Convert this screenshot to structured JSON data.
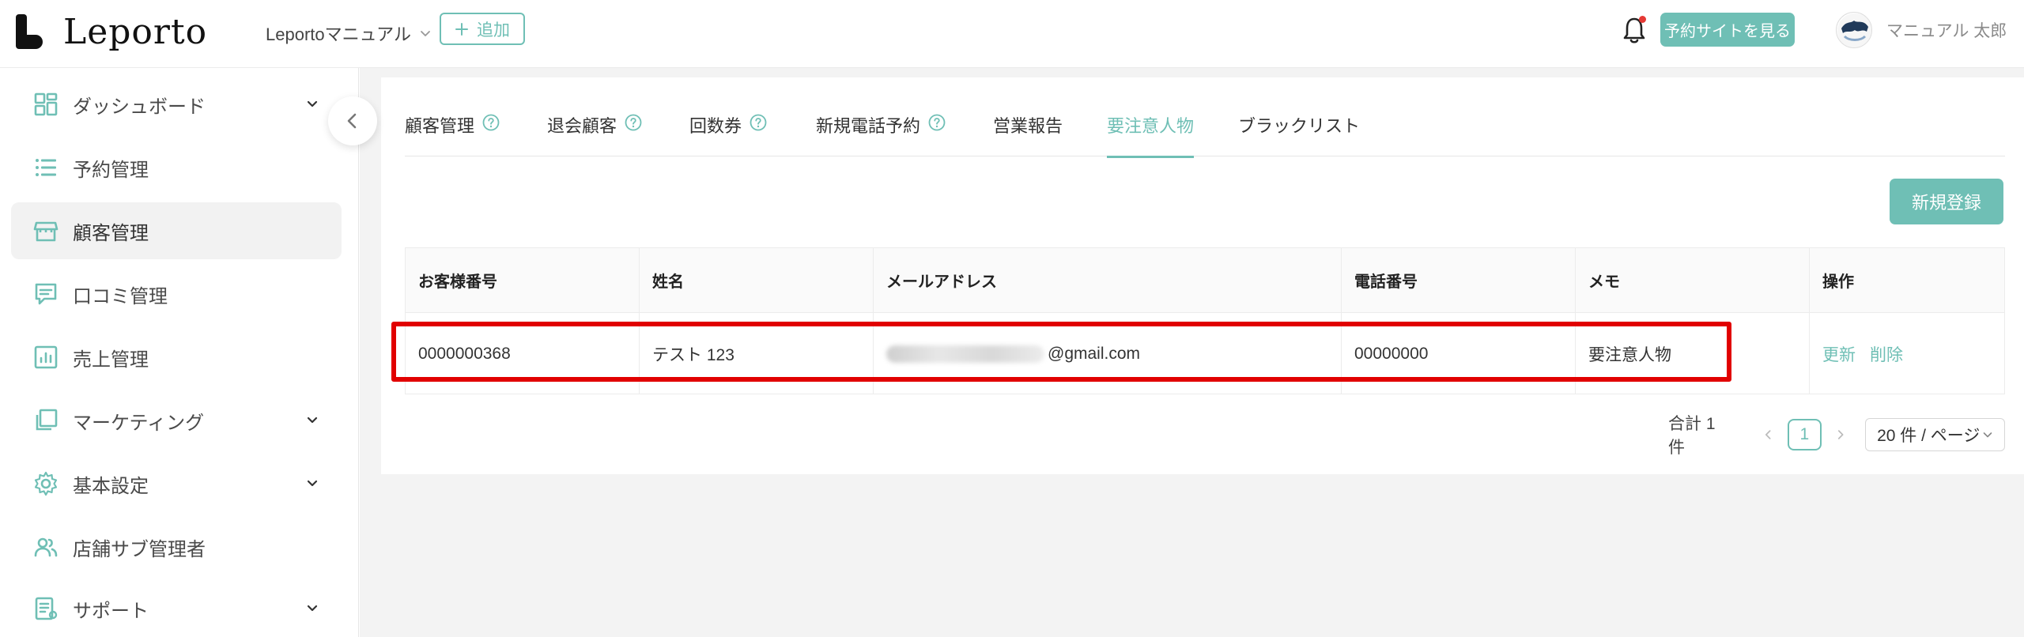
{
  "brand": {
    "name": "Leporto"
  },
  "header": {
    "store_name": "Leportoマニュアル",
    "add_label": "追加",
    "reserve_site_label": "予約サイトを見る",
    "user_name": "マニュアル 太郎"
  },
  "sidebar": {
    "items": [
      {
        "label": "ダッシュボード",
        "icon": "dashboard-icon",
        "has_caret": true
      },
      {
        "label": "予約管理",
        "icon": "list-icon",
        "has_caret": false
      },
      {
        "label": "顧客管理",
        "icon": "store-icon",
        "has_caret": false,
        "active": true
      },
      {
        "label": "口コミ管理",
        "icon": "comment-icon",
        "has_caret": false
      },
      {
        "label": "売上管理",
        "icon": "chart-icon",
        "has_caret": false
      },
      {
        "label": "マーケティング",
        "icon": "layers-icon",
        "has_caret": true
      },
      {
        "label": "基本設定",
        "icon": "gear-icon",
        "has_caret": true
      },
      {
        "label": "店舗サブ管理者",
        "icon": "users-icon",
        "has_caret": false
      },
      {
        "label": "サポート",
        "icon": "doc-icon",
        "has_caret": true
      }
    ]
  },
  "tabs": [
    {
      "label": "顧客管理",
      "help": true
    },
    {
      "label": "退会顧客",
      "help": true
    },
    {
      "label": "回数券",
      "help": true
    },
    {
      "label": "新規電話予約",
      "help": true
    },
    {
      "label": "営業報告",
      "help": false
    },
    {
      "label": "要注意人物",
      "help": false,
      "active": true
    },
    {
      "label": "ブラックリスト",
      "help": false
    }
  ],
  "actions": {
    "new_label": "新規登録"
  },
  "table": {
    "columns": [
      "お客様番号",
      "姓名",
      "メールアドレス",
      "電話番号",
      "メモ",
      "操作"
    ],
    "rows": [
      {
        "customer_no": "0000000368",
        "name": "テスト 123",
        "email_suffix": "@gmail.com",
        "phone": "00000000",
        "memo": "要注意人物",
        "update_label": "更新",
        "delete_label": "削除"
      }
    ]
  },
  "pagination": {
    "total_label": "合計 1 件",
    "current_page": "1",
    "page_size_label": "20 件 / ページ"
  },
  "colors": {
    "accent": "#6fbfb5",
    "highlight": "#e10000"
  }
}
